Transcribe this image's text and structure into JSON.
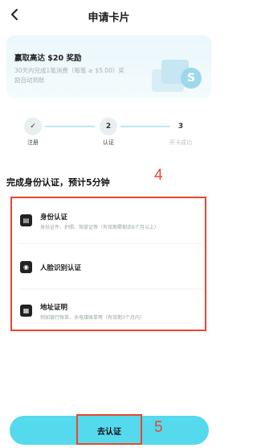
{
  "header": {
    "title": "申请卡片",
    "back_icon": "chevron-left-icon"
  },
  "promo": {
    "title": "赢取高达 $20 奖励",
    "subtitle": "30天内完成1笔消费（每笔 ≥ $5.00）奖励自动到账",
    "coin_symbol": "S"
  },
  "steps": [
    {
      "marker": "✓",
      "label": "注册",
      "state": "done"
    },
    {
      "marker": "2",
      "label": "认证",
      "state": "current"
    },
    {
      "marker": "3",
      "label": "开卡成功",
      "state": "pending"
    }
  ],
  "section": {
    "title": "完成身份认证，预计5分钟"
  },
  "annotations": {
    "list": "4",
    "button": "5"
  },
  "verification_items": [
    {
      "icon": "id-card-icon",
      "title": "身份认证",
      "desc": "身份证件、护照、驾驶证等（有效期需剩余6个月以上）"
    },
    {
      "icon": "camera-icon",
      "title": "人脸识别认证",
      "desc": ""
    },
    {
      "icon": "document-icon",
      "title": "地址证明",
      "desc": "例如银行账单、水电煤账单等（有效期3个月内）"
    }
  ],
  "cta": {
    "label": "去认证"
  },
  "colors": {
    "accent": "#55d9ec",
    "annotation": "#e8472f"
  }
}
